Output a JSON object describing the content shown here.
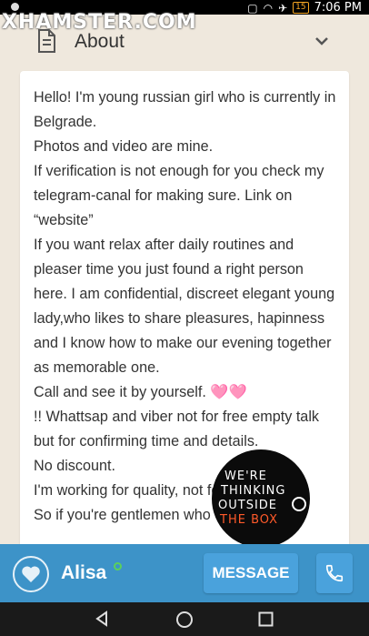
{
  "status_bar": {
    "time": "7:06 PM",
    "battery": "15"
  },
  "watermark": {
    "text": "XHAMSTER.COM"
  },
  "header": {
    "title": "About"
  },
  "about": {
    "paragraphs": [
      "Hello! I'm young russian girl who is currently in Belgrade.",
      "Photos and video are mine.",
      "If verification is not enough for you check my telegram-canal for making sure. Link on “website”",
      "If you want relax after daily routines and pleaser time you just found a right person here. I am confidential, discreet elegant young lady,who likes to share pleasures, hapinness and I know how to make our evening together as memorable one.",
      "Call and see it by yourself. 🩷🩷",
      "!! Whattsap and viber not for free empty talk but for confirming time and details.",
      "No discount.",
      "I'm working for quality, not for quantity.",
      "So if you're gentlemen who"
    ]
  },
  "sticker": {
    "line1": "WE'RE",
    "line2": "THINKING",
    "line3": "OUTSIDE",
    "line4": "THE BOX"
  },
  "bottom_bar": {
    "name": "Alisa",
    "message_label": "MESSAGE"
  },
  "icons": {
    "doc": "document-icon",
    "chevron": "chevron-down-icon",
    "heart": "heart-icon",
    "phone": "phone-icon",
    "nav_back": "back-triangle-icon",
    "nav_home": "home-circle-icon",
    "nav_recent": "recent-square-icon"
  },
  "colors": {
    "accent": "#3d93c8",
    "button": "#4aa2dc",
    "online": "#5bd05b",
    "background": "#efe8dd"
  }
}
